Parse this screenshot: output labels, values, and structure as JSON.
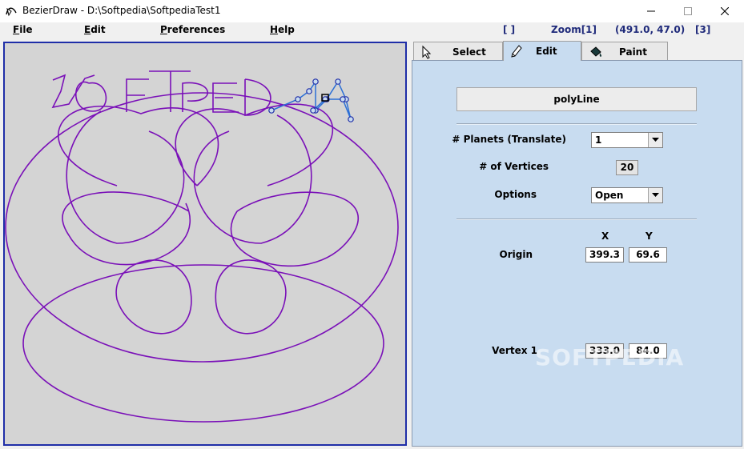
{
  "window": {
    "title": "BezierDraw - D:\\Softpedia\\SoftpediaTest1"
  },
  "menu": {
    "file": "File",
    "edit": "Edit",
    "preferences": "Preferences",
    "help": "Help"
  },
  "status": {
    "brackets": "[ ]",
    "zoom": "Zoom[1]",
    "coords": "(491.0, 47.0)",
    "count": "[3]"
  },
  "tabs": [
    {
      "label": "Select",
      "icon": "cursor-icon"
    },
    {
      "label": "Edit",
      "icon": "pencil-icon"
    },
    {
      "label": "Paint",
      "icon": "paint-bucket-icon"
    }
  ],
  "active_tab": "Edit",
  "edit_panel": {
    "shape_type": "polyLine",
    "planets_label": "# Planets (Translate)",
    "planets_value": "1",
    "vertices_label": "# of Vertices",
    "vertices_value": "20",
    "options_label": "Options",
    "options_value": "Open",
    "col_x": "X",
    "col_y": "Y",
    "origin_label": "Origin",
    "origin_x": "399.3",
    "origin_y": "69.6",
    "vertex_label": "Vertex 1",
    "vertex_x": "333.0",
    "vertex_y": "84.0"
  },
  "watermark": "SOFTPEDIA",
  "colors": {
    "stroke": "#7a10b8",
    "selection": "#2b6fd6",
    "panel": "#c8dcf0",
    "canvas": "#d4d4d4",
    "canvas_border": "#1f2ea8"
  }
}
